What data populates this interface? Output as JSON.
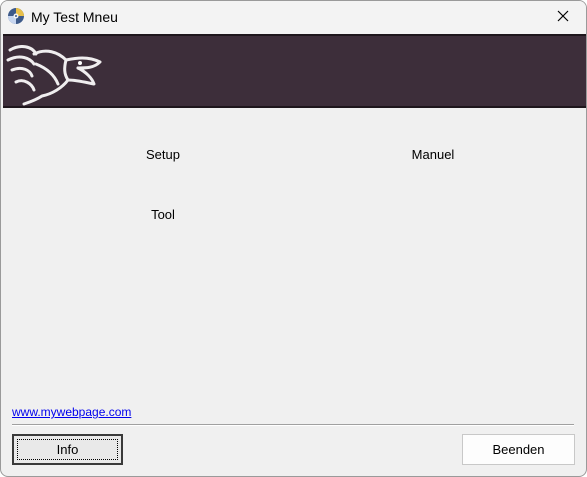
{
  "window": {
    "title": "My Test Mneu"
  },
  "menu": {
    "setup": "Setup",
    "manuel": "Manuel",
    "tool": "Tool"
  },
  "footer": {
    "website": "www.mywebpage.com",
    "info_button": "Info",
    "exit_button": "Beenden"
  },
  "icons": {
    "app": "disc-icon",
    "close": "close-icon",
    "logo": "dragon-logo-icon"
  },
  "colors": {
    "banner": "#3d2e3a",
    "link": "#0000ee",
    "window_bg": "#f0f0f0"
  }
}
